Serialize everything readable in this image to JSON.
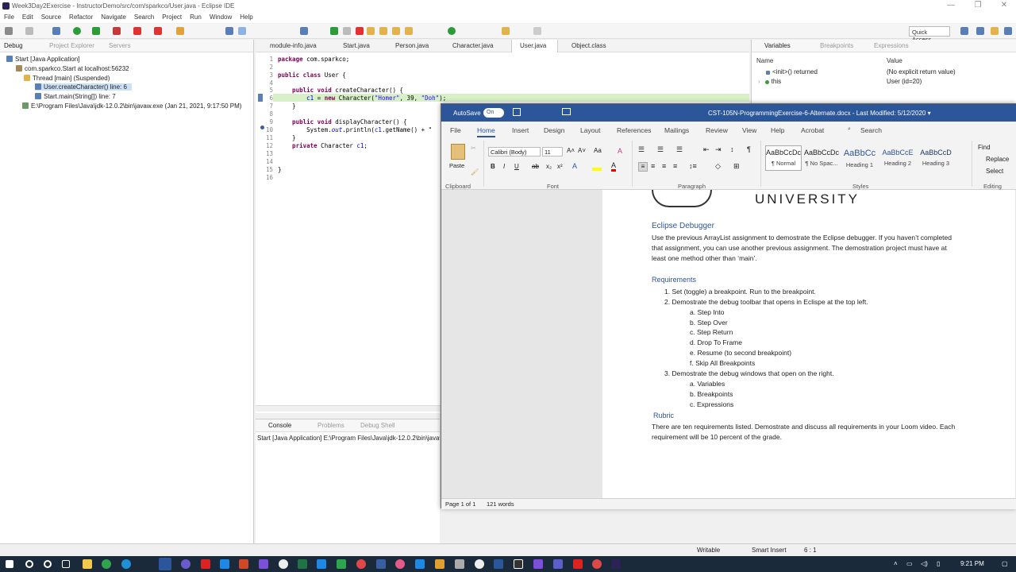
{
  "window": {
    "title": "Week3Day2Exercise - InstructorDemo/src/com/sparkco/User.java - Eclipse IDE",
    "min": "—",
    "max": "❐",
    "close": "✕"
  },
  "menu": [
    "File",
    "Edit",
    "Source",
    "Refactor",
    "Navigate",
    "Search",
    "Project",
    "Run",
    "Window",
    "Help"
  ],
  "toolbar": {
    "quick_access": "Quick Access"
  },
  "left_panel": {
    "tabs": [
      "Debug",
      "Project Explorer",
      "Servers"
    ],
    "tree": [
      "Start [Java Application]",
      "com.sparkco.Start at localhost:56232",
      "Thread [main] (Suspended)",
      "User.createCharacter() line: 6",
      "Start.main(String[]) line: 7",
      "E:\\Program Files\\Java\\jdk-12.0.2\\bin\\javaw.exe (Jan 21, 2021, 9:17:50 PM)"
    ]
  },
  "editor": {
    "tabs": [
      "module-info.java",
      "Start.java",
      "Person.java",
      "Character.java",
      "User.java",
      "Object.class"
    ],
    "line_numbers": [
      "1",
      "2",
      "3",
      "4",
      "5",
      "6",
      "7",
      "8",
      "9",
      "10",
      "11",
      "12",
      "13",
      "14",
      "15",
      "16"
    ]
  },
  "code": {
    "l1a": "package",
    "l1b": " com.sparkco;",
    "l3a": "public class",
    "l3b": " User {",
    "l5a": "    public void",
    "l5b": " createCharacter() {",
    "l6a": "        c1",
    "l6b": " = ",
    "l6c": "new",
    "l6d": " Character(",
    "l6e": "\"Homer\"",
    "l6f": ", 39, ",
    "l6g": "\"Doh\"",
    "l6h": ");",
    "l7": "    }",
    "l9a": "    public void",
    "l9b": " displayCharacter() {",
    "l10a": "        System.",
    "l10b": "out",
    "l10c": ".println(",
    "l10d": "c1",
    "l10e": ".getName() + \"",
    "l11": "    }",
    "l12a": "    private",
    "l12b": " Character ",
    "l12c": "c1",
    ";": ";",
    "l15": "}"
  },
  "variables": {
    "tabs": [
      "Variables",
      "Breakpoints",
      "Expressions"
    ],
    "col_name": "Name",
    "col_value": "Value",
    "rows": [
      {
        "name": "<init>() returned",
        "value": "(No explicit return value)"
      },
      {
        "name": "this",
        "value": "User  (id=20)"
      }
    ]
  },
  "console": {
    "tabs": [
      "Console",
      "Problems",
      "Debug Shell"
    ],
    "line": "Start [Java Application] E:\\Program Files\\Java\\jdk-12.0.2\\bin\\javaw"
  },
  "status": {
    "writable": "Writable",
    "insert": "Smart Insert",
    "pos": "6 : 1"
  },
  "word": {
    "autosave": "AutoSave",
    "toggle": "On",
    "title": "CST-105N-ProgrammingExercise-6-Alternate.docx  -  Last Modified: 5/12/2020  ▾",
    "tabs": [
      "File",
      "Home",
      "Insert",
      "Design",
      "Layout",
      "References",
      "Mailings",
      "Review",
      "View",
      "Help",
      "Acrobat"
    ],
    "search": "Search",
    "font_name": "Calibri (Body)",
    "font_size": "11",
    "groups": [
      "Clipboard",
      "Font",
      "Paragraph",
      "Styles",
      "Editing"
    ],
    "paste": "Paste",
    "styles": [
      {
        "pv": "AaBbCcDc",
        "nm": "¶ Normal"
      },
      {
        "pv": "AaBbCcDc",
        "nm": "¶ No Spac..."
      },
      {
        "pv": "AaBbCc",
        "nm": "Heading 1"
      },
      {
        "pv": "AaBbCcE",
        "nm": "Heading 2"
      },
      {
        "pv": "AaBbCcD",
        "nm": "Heading 3"
      }
    ],
    "editing": [
      "Find",
      "Replace",
      "Select"
    ],
    "university": "UNIVERSITY",
    "heading": "Eclipse Debugger",
    "intro": [
      "Use the previous ArrayList assignment to demostrate the Eclipse debugger.  If you haven’t completed",
      "that assignment, you can use another previous assignment.  The demostration project must have at",
      "least one method other than ‘main’."
    ],
    "req_heading": "Requirements",
    "req": [
      "1.   Set (toggle) a breakpoint.  Run to the breakpoint.",
      "2.   Demostrate the debug toolbar that opens in Eclispe at the top left.",
      "a.   Step Into",
      "b.   Step Over",
      "c.   Step Return",
      "d.   Drop To Frame",
      "e.   Resume (to second breakpoint)",
      "f.   Skip All Breakpoints",
      "3.   Demostrate the debug windows that open on the right.",
      "a.   Variables",
      "b.   Breakpoints",
      "c.   Expressions"
    ],
    "rubric": "Rubric",
    "rubric_text": [
      "There are ten requirements listed.  Demostrate and discuss all requirements in your Loom video.  Each",
      "requirement will be 10 percent of the grade."
    ],
    "page": "Page 1 of 1",
    "words": "121 words"
  },
  "taskbar": {
    "time": "9:21 PM"
  }
}
